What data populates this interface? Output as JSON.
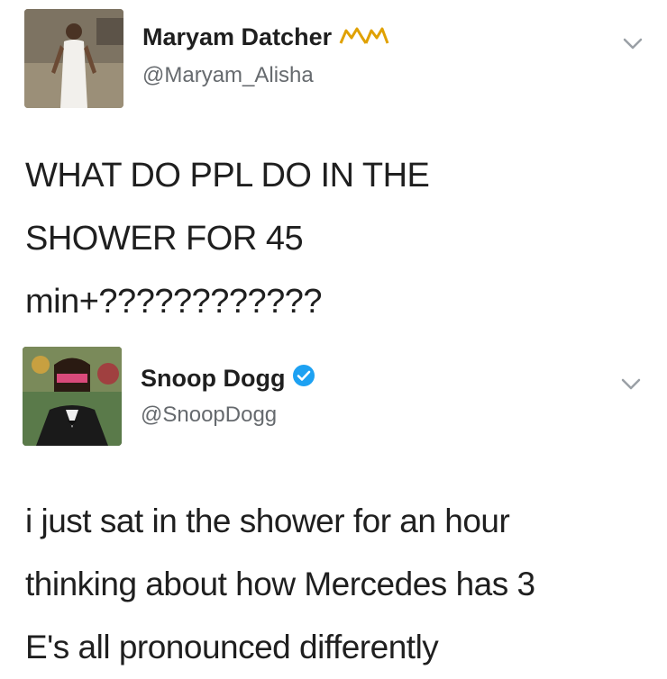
{
  "tweets": [
    {
      "display_name": "Maryam Datcher",
      "handle": "@Maryam_Alisha",
      "name_emoji_icon": "crown-icon",
      "text_lines": [
        "WHAT DO PPL DO IN THE",
        "SHOWER FOR 45",
        "min+????????????"
      ]
    },
    {
      "display_name": "Snoop Dogg",
      "handle": "@SnoopDogg",
      "verified_icon": "verified-badge-icon",
      "text_lines": [
        "i just sat in the shower for an hour",
        "thinking about how Mercedes has 3",
        "E's all pronounced differently"
      ]
    }
  ],
  "colors": {
    "text": "#1f1f1f",
    "handle": "#666a6e",
    "verified": "#1da1f2",
    "emoji": "#e0a100"
  }
}
